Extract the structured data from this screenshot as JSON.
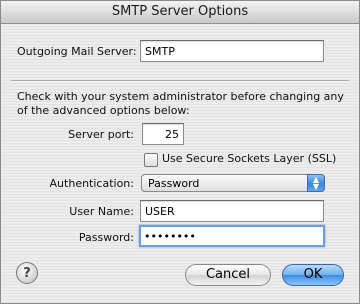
{
  "window": {
    "title": "SMTP Server Options"
  },
  "outgoing": {
    "label": "Outgoing Mail Server:",
    "value": "SMTP"
  },
  "note": "Check with your system administrator before changing any of the advanced options below:",
  "port": {
    "label": "Server port:",
    "value": "25"
  },
  "ssl": {
    "label": "Use Secure Sockets Layer (SSL)",
    "checked": false
  },
  "auth": {
    "label": "Authentication:",
    "value": "Password"
  },
  "username": {
    "label": "User Name:",
    "value": "USER"
  },
  "password": {
    "label": "Password:",
    "value": "••••••••"
  },
  "buttons": {
    "help": "?",
    "cancel": "Cancel",
    "ok": "OK"
  }
}
